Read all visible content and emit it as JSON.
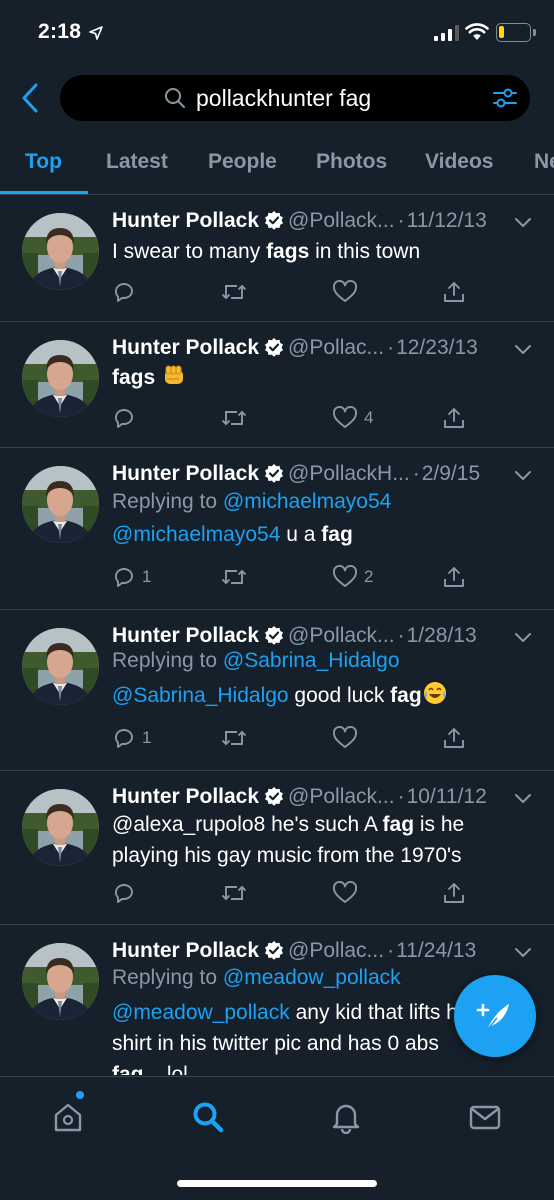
{
  "status_bar": {
    "time": "2:18"
  },
  "search": {
    "query": "pollackhunter fag"
  },
  "tabs": [
    {
      "label": "Top",
      "active": true
    },
    {
      "label": "Latest"
    },
    {
      "label": "People"
    },
    {
      "label": "Photos"
    },
    {
      "label": "Videos"
    },
    {
      "label": "News"
    }
  ],
  "tweets": [
    {
      "name": "Hunter Pollack",
      "handle": "@Pollack...",
      "date": "11/12/13",
      "text_parts": [
        "I swear to many ",
        "fags",
        " in this town"
      ],
      "reply_count": "",
      "like_count": ""
    },
    {
      "name": "Hunter Pollack",
      "handle": "@Pollac...",
      "date": "12/23/13",
      "text_parts": [
        "fags"
      ],
      "emoji": "fist-emoji",
      "reply_count": "",
      "like_count": "4"
    },
    {
      "name": "Hunter Pollack",
      "handle": "@PollackH...",
      "date": "2/9/15",
      "replying_label": "Replying to",
      "replying_to": "@michaelmayo54",
      "text_parts": [
        "@michaelmayo54",
        " u a ",
        "fag"
      ],
      "reply_count": "1",
      "like_count": "2"
    },
    {
      "name": "Hunter Pollack",
      "handle": "@Pollack...",
      "date": "1/28/13",
      "replying_label": "Replying to",
      "replying_to": "@Sabrina_Hidalgo",
      "text_parts": [
        "@Sabrina_Hidalgo",
        " good luck ",
        "fag"
      ],
      "emoji": "tears-of-joy-emoji",
      "reply_count": "1",
      "like_count": ""
    },
    {
      "name": "Hunter Pollack",
      "handle": "@Pollack...",
      "date": "10/11/12",
      "text_line1_parts": [
        "@alexa_rupolo8 he's such A ",
        "fag",
        " is he"
      ],
      "text_line2": "playing his gay music from the 1970's",
      "reply_count": "",
      "like_count": ""
    },
    {
      "name": "Hunter Pollack",
      "handle": "@Pollac...",
      "date": "11/24/13",
      "replying_label": "Replying to",
      "replying_to": "@meadow_pollack",
      "text_line1_parts": [
        "@meadow_pollack",
        " any kid that lifts his"
      ],
      "text_line2": "shirt in his twitter pic and has 0 abs",
      "text_line3_parts": [
        "fag",
        " ...lol"
      ]
    }
  ],
  "colors": {
    "background": "#15202b",
    "accent": "#1da1f2",
    "secondary_text": "#8899a6",
    "divider": "#38444d"
  },
  "icons": {
    "actions": [
      "reply-icon",
      "retweet-icon",
      "like-icon",
      "share-icon"
    ],
    "tabbar": [
      "home-icon",
      "search-icon",
      "notifications-icon",
      "messages-icon"
    ],
    "fab": "compose-tweet-icon"
  }
}
